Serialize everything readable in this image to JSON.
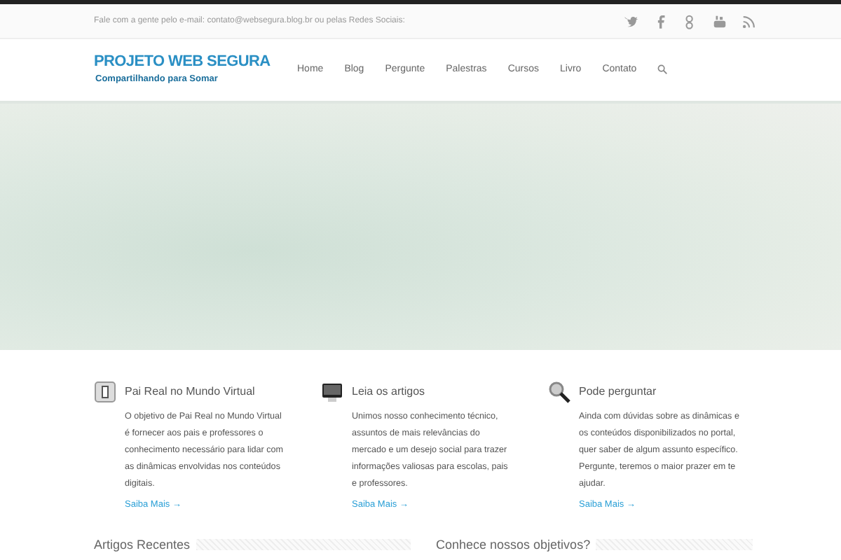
{
  "topbar": {
    "text": "Fale com a gente pelo e-mail: contato@websegura.blog.br ou pelas Redes Sociais:"
  },
  "logo": {
    "title": "PROJETO WEB SEGURA",
    "tagline": "Compartilhando para Somar"
  },
  "nav": [
    {
      "label": "Home"
    },
    {
      "label": "Blog"
    },
    {
      "label": "Pergunte"
    },
    {
      "label": "Palestras"
    },
    {
      "label": "Cursos"
    },
    {
      "label": "Livro"
    },
    {
      "label": "Contato"
    }
  ],
  "features": [
    {
      "title": "Pai Real no Mundo Virtual",
      "text": "O objetivo de Pai Real no Mundo Virtual é fornecer aos pais e professores o conhecimento necessário para lidar com as dinâmicas envolvidas nos conteúdos digitais.",
      "link": "Saiba Mais →"
    },
    {
      "title": "Leia os artigos",
      "text": "Unimos nosso conhecimento técnico, assuntos de mais relevâncias do mercado e um desejo social para trazer informações valiosas para escolas, pais e professores.",
      "link": "Saiba Mais →"
    },
    {
      "title": "Pode perguntar",
      "text": "Ainda com dúvidas sobre as dinâmicas e os conteúdos disponibilizados no portal, quer saber de algum assunto específico. Pergunte, teremos o maior prazer em te ajudar.",
      "link": "Saiba Mais →"
    }
  ],
  "sections": [
    {
      "title": "Artigos Recentes"
    },
    {
      "title": "Conhece nossos objetivos?"
    }
  ]
}
